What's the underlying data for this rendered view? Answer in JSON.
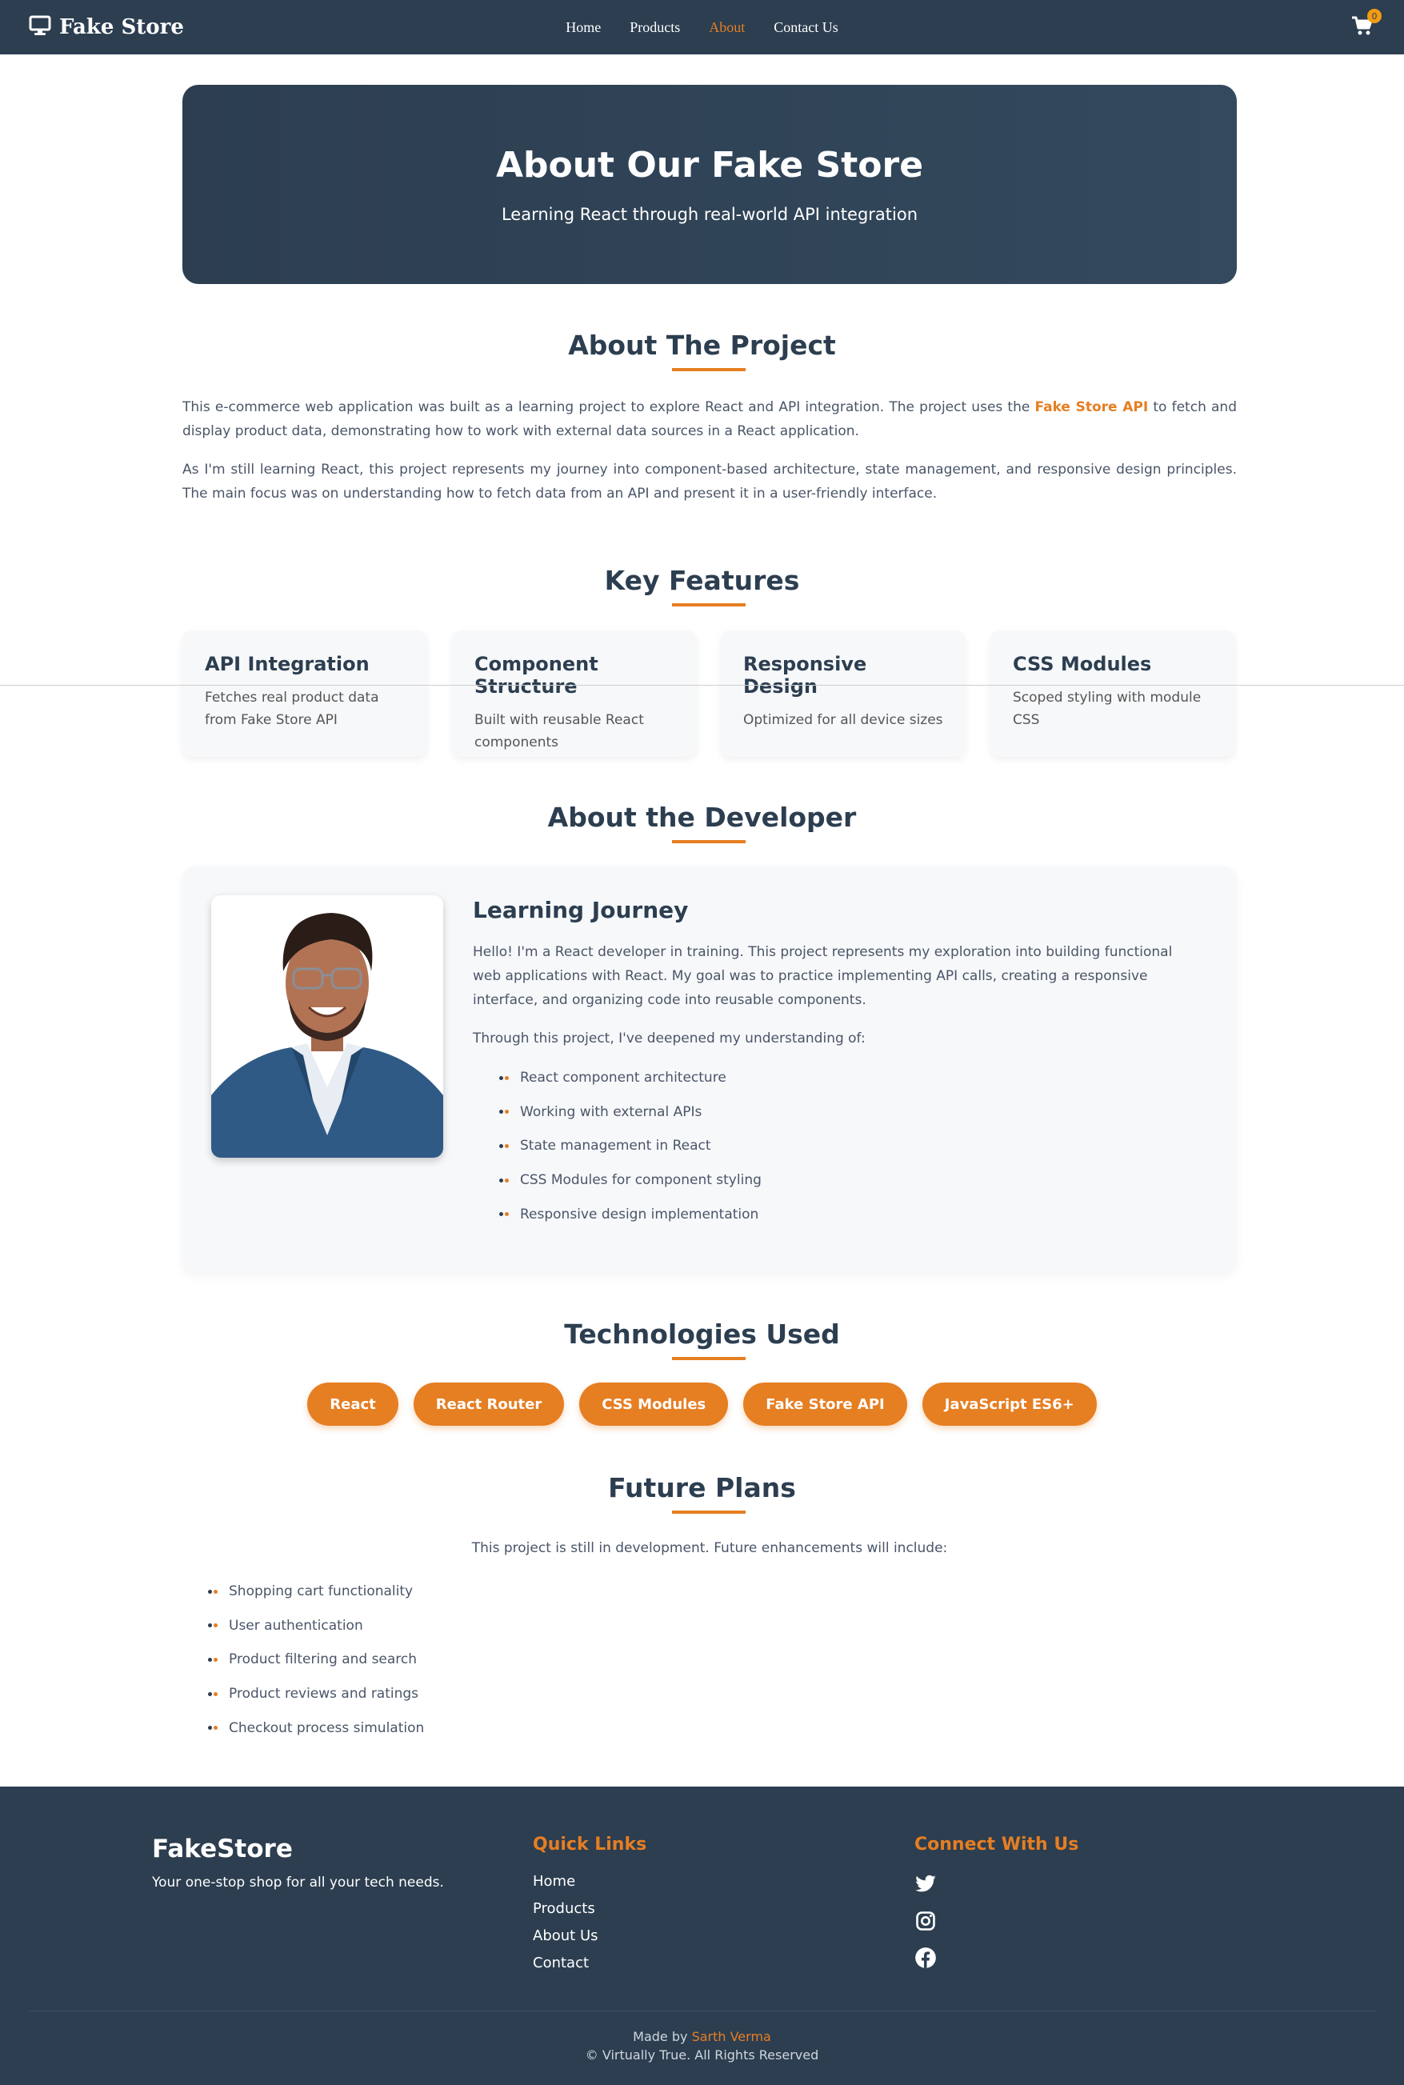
{
  "navbar": {
    "brand": "Fake Store",
    "links": [
      "Home",
      "Products",
      "About",
      "Contact Us"
    ],
    "active": "About",
    "cart_count": "0"
  },
  "hero": {
    "title": "About Our Fake Store",
    "subtitle": "Learning React through real-world API integration"
  },
  "about_project": {
    "title": "About The Project",
    "p1_before": "This e-commerce web application was built as a learning project to explore React and API integration. The project uses the ",
    "p1_link": "Fake Store API",
    "p1_after": " to fetch and display product data, demonstrating how to work with external data sources in a React application.",
    "p2": "As I'm still learning React, this project represents my journey into component-based architecture, state management, and responsive design principles. The main focus was on understanding how to fetch data from an API and present it in a user-friendly interface."
  },
  "features": {
    "title": "Key Features",
    "items": [
      {
        "title": "API Integration",
        "desc": "Fetches real product data from Fake Store API"
      },
      {
        "title": "Component Structure",
        "desc": "Built with reusable React components"
      },
      {
        "title": "Responsive Design",
        "desc": "Optimized for all device sizes"
      },
      {
        "title": "CSS Modules",
        "desc": "Scoped styling with module CSS"
      }
    ]
  },
  "developer": {
    "title": "About the Developer",
    "card_title": "Learning Journey",
    "intro": "Hello! I'm a React developer in training. This project represents my exploration into building functional web applications with React. My goal was to practice implementing API calls, creating a responsive interface, and organizing code into reusable components.",
    "lead": "Through this project, I've deepened my understanding of:",
    "skills": [
      "React component architecture",
      "Working with external APIs",
      "State management in React",
      "CSS Modules for component styling",
      "Responsive design implementation"
    ]
  },
  "technologies": {
    "title": "Technologies Used",
    "items": [
      "React",
      "React Router",
      "CSS Modules",
      "Fake Store API",
      "JavaScript ES6+"
    ]
  },
  "future": {
    "title": "Future Plans",
    "intro": "This project is still in development. Future enhancements will include:",
    "items": [
      "Shopping cart functionality",
      "User authentication",
      "Product filtering and search",
      "Product reviews and ratings",
      "Checkout process simulation"
    ]
  },
  "footer": {
    "brand": "FakeStore",
    "tagline": "Your one-stop shop for all your tech needs.",
    "quick_links_title": "Quick Links",
    "quick_links": [
      "Home",
      "Products",
      "About Us",
      "Contact"
    ],
    "connect_title": "Connect With Us",
    "social_icons": [
      "twitter-icon",
      "instagram-icon",
      "facebook-icon"
    ],
    "made_by_prefix": "Made by ",
    "made_by_name": "Sarth Verma",
    "copyright": "© Virtually True. All Rights Reserved"
  },
  "colors": {
    "navy": "#2c3e50",
    "accent": "#e67e22",
    "card_bg": "#f7f8fa"
  }
}
